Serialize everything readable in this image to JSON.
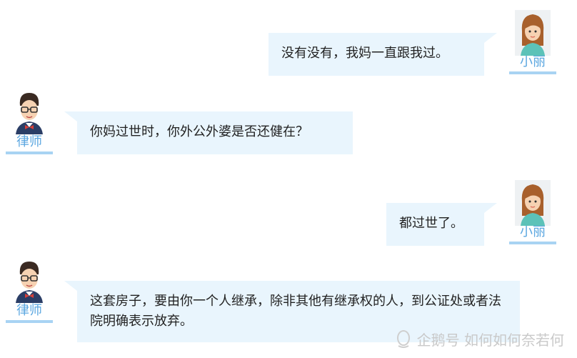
{
  "conversation": {
    "speakers": {
      "client": "小丽",
      "lawyer": "律师"
    },
    "messages": [
      {
        "speaker": "client",
        "text": "没有没有，我妈一直跟我过。"
      },
      {
        "speaker": "lawyer",
        "text": "你妈过世时，你外公外婆是否还健在？"
      },
      {
        "speaker": "client",
        "text": "都过世了。"
      },
      {
        "speaker": "lawyer",
        "text": "这套房子，要由你一个人继承，除非其他有继承权的人，到公证处或者法院明确表示放弃。"
      }
    ]
  },
  "watermark": {
    "text": "企鹅号 如何如何奈若何"
  },
  "colors": {
    "bubble": "#e9f5fd",
    "name": "#5aa6e0",
    "underline": "#a8d3f3"
  }
}
